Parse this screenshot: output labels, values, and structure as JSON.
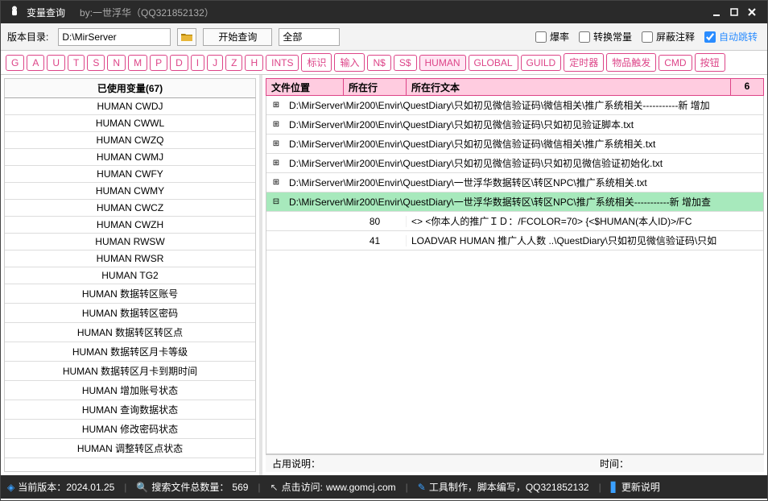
{
  "titlebar": {
    "title": "变量查询",
    "by": "by:一世浮华（QQ321852132）"
  },
  "toolbar": {
    "ver_label": "版本目录:",
    "path": "D:\\MirServer",
    "start_btn": "开始查询",
    "filter_sel": "全部",
    "chk_baolv": "爆率",
    "chk_zhuanhuan": "转换常量",
    "chk_pingbi": "屏蔽注释",
    "chk_auto": "自动跳转"
  },
  "filters": [
    "G",
    "A",
    "U",
    "T",
    "S",
    "N",
    "M",
    "P",
    "D",
    "I",
    "J",
    "Z",
    "H",
    "INTS",
    "标识",
    "输入",
    "N$",
    "S$",
    "HUMAN",
    "GLOBAL",
    "GUILD",
    "定时器",
    "物品触发",
    "CMD",
    "按钮"
  ],
  "filter_selected_index": 18,
  "left": {
    "header": "已使用变量(67)",
    "items": [
      "HUMAN CWDJ",
      "HUMAN CWWL",
      "HUMAN CWZQ",
      "HUMAN CWMJ",
      "HUMAN CWFY",
      "HUMAN CWMY",
      "HUMAN CWCZ",
      "HUMAN CWZH",
      "HUMAN RWSW",
      "HUMAN RWSR",
      "HUMAN TG2",
      "HUMAN 数据转区账号",
      "HUMAN 数据转区密码",
      "HUMAN 数据转区转区点",
      "HUMAN 数据转区月卡等级",
      "HUMAN 数据转区月卡到期时间",
      "HUMAN 增加账号状态",
      "HUMAN 查询数据状态",
      "HUMAN 修改密码状态",
      "HUMAN 调整转区点状态"
    ]
  },
  "right": {
    "headers": {
      "c1": "文件位置",
      "c2": "所在行",
      "c3": "所在行文本",
      "c4": "6"
    },
    "rows": [
      {
        "type": "file",
        "text": "D:\\MirServer\\Mir200\\Envir\\QuestDiary\\只如初见微信验证码\\微信相关\\推广系统相关-----------新 增加"
      },
      {
        "type": "file",
        "text": "D:\\MirServer\\Mir200\\Envir\\QuestDiary\\只如初见微信验证码\\只如初见验证脚本.txt"
      },
      {
        "type": "file",
        "text": "D:\\MirServer\\Mir200\\Envir\\QuestDiary\\只如初见微信验证码\\微信相关\\推广系统相关.txt"
      },
      {
        "type": "file",
        "text": "D:\\MirServer\\Mir200\\Envir\\QuestDiary\\只如初见微信验证码\\只如初见微信验证初始化.txt"
      },
      {
        "type": "file",
        "text": "D:\\MirServer\\Mir200\\Envir\\QuestDiary\\一世浮华数据转区\\转区NPC\\推广系统相关.txt"
      },
      {
        "type": "file",
        "selected": true,
        "text": "D:\\MirServer\\Mir200\\Envir\\QuestDiary\\一世浮华数据转区\\转区NPC\\推广系统相关-----------新 增加查"
      },
      {
        "type": "sub",
        "c1": "",
        "c2": "80",
        "c3": "<>     <你本人的推广ＩＤ：/FCOLOR=70>  {<$HUMAN(本人ID)>/FC"
      },
      {
        "type": "sub",
        "c1": "",
        "c2": "41",
        "c3": "LOADVAR  HUMAN 推广人人数 ..\\QuestDiary\\只如初见微信验证码\\只如"
      }
    ],
    "footer": {
      "l1": "占用说明：",
      "l2": "时间："
    }
  },
  "status": {
    "ver": "当前版本：2024.01.25",
    "count_label": "搜索文件总数量：",
    "count": "569",
    "url_label": "点击访问:",
    "url": "www.gomcj.com",
    "tool": "工具制作，脚本编写，QQ321852132",
    "update": "更新说明"
  }
}
